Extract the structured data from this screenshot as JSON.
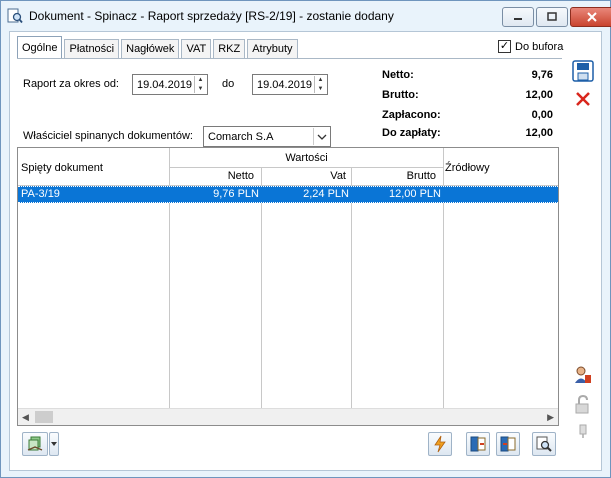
{
  "window": {
    "title": "Dokument - Spinacz - Raport sprzedaży [RS-2/19]  - zostanie dodany"
  },
  "tabs": [
    "Ogólne",
    "Płatności",
    "Nagłówek",
    "VAT",
    "RKZ",
    "Atrybuty"
  ],
  "buffer_checkbox": {
    "label": "Do bufora",
    "checked": true
  },
  "form": {
    "period_label": "Raport za okres od:",
    "date_from": "19.04.2019",
    "to_label": "do",
    "date_to": "19.04.2019",
    "owner_label": "Właściciel spinanych dokumentów:",
    "owner_value": "Comarch S.A"
  },
  "summary": {
    "netto_label": "Netto:",
    "netto_value": "9,76",
    "brutto_label": "Brutto:",
    "brutto_value": "12,00",
    "paid_label": "Zapłacono:",
    "paid_value": "0,00",
    "due_label": "Do zapłaty:",
    "due_value": "12,00"
  },
  "grid": {
    "col_doc": "Spięty dokument",
    "group_values": "Wartości",
    "col_netto": "Netto",
    "col_vat": "Vat",
    "col_brutto": "Brutto",
    "col_source": "Źródłowy",
    "rows": [
      {
        "doc": "PA-3/19",
        "netto": "9,76 PLN",
        "vat": "2,24 PLN",
        "brutto": "12,00 PLN",
        "source": ""
      }
    ]
  },
  "colors": {
    "selection": "#0a75d6",
    "accent": "#1d5fa8",
    "close": "#c9442f"
  }
}
